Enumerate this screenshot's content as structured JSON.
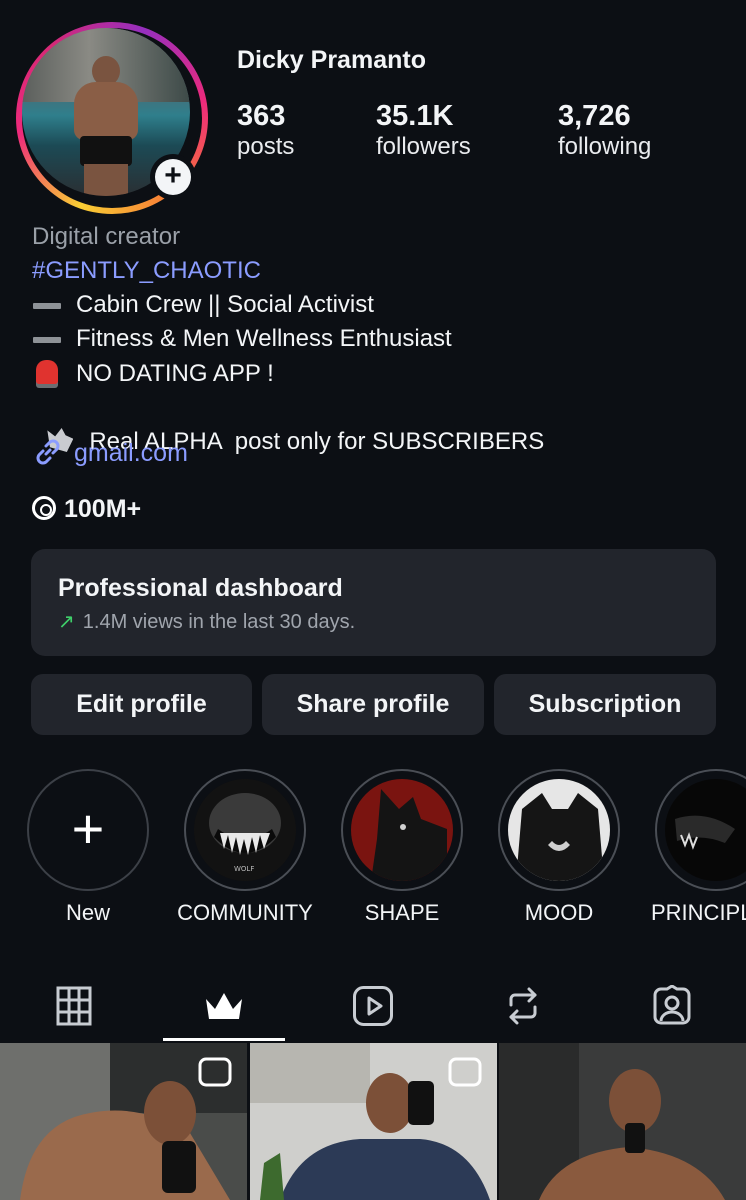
{
  "profile": {
    "name": "Dicky Pramanto",
    "stats": [
      {
        "value": "363",
        "label": "posts"
      },
      {
        "value": "35.1K",
        "label": "followers"
      },
      {
        "value": "3,726",
        "label": "following"
      }
    ]
  },
  "bio": {
    "category": "Digital creator",
    "hashtag": "#GENTLY_CHAOTIC",
    "lines": [
      {
        "icon": "dash-icon",
        "text": "Cabin Crew || Social Activist"
      },
      {
        "icon": "dash-icon",
        "text": "Fitness & Men Wellness Enthusiast"
      },
      {
        "icon": "siren-icon",
        "text": "NO DATING APP !"
      },
      {
        "icon": "wolf-icon",
        "text": "Real ALPHA  post only for SUBSCRIBERS"
      }
    ],
    "link": "gmail.com",
    "threads": "100M+"
  },
  "dashboard": {
    "title": "Professional dashboard",
    "subtitle": "1.4M views in the last 30 days."
  },
  "buttons": {
    "edit": "Edit profile",
    "share": "Share profile",
    "subscription": "Subscription"
  },
  "highlights": [
    {
      "label": "New"
    },
    {
      "label": "COMMUNITY"
    },
    {
      "label": "SHAPE"
    },
    {
      "label": "MOOD"
    },
    {
      "label": "PRINCIPL"
    }
  ],
  "tabs": [
    "grid-icon",
    "crown-icon",
    "reels-icon",
    "reposts-icon",
    "tagged-icon"
  ],
  "colors": {
    "background": "#0c0f14",
    "card": "#22252c",
    "link": "#8b9cff",
    "trend": "#3fcf6a"
  }
}
